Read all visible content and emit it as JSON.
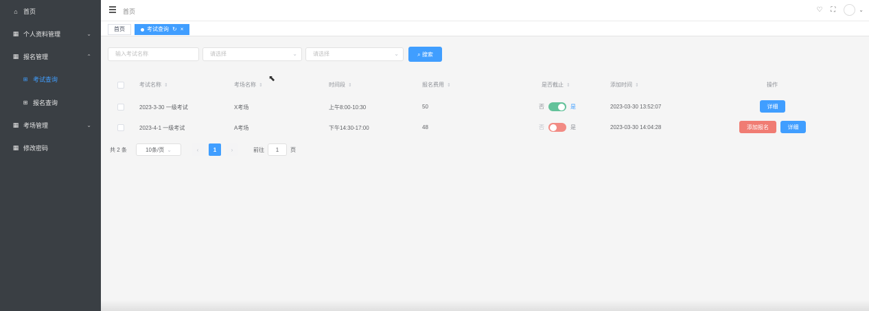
{
  "sidebar": {
    "items": [
      {
        "icon": "home-icon",
        "glyph": "⌂",
        "label": "首页"
      },
      {
        "icon": "grid-icon",
        "glyph": "▦",
        "label": "个人资料管理",
        "chevron": "⌄"
      },
      {
        "icon": "grid-icon",
        "glyph": "▦",
        "label": "报名管理",
        "chevron": "⌃"
      },
      {
        "icon": "sub-grid-icon",
        "glyph": "⊞",
        "label": "考试查询",
        "active": true
      },
      {
        "icon": "sub-grid-icon",
        "glyph": "⊞",
        "label": "报名查询"
      },
      {
        "icon": "grid-icon",
        "glyph": "▦",
        "label": "考场管理",
        "chevron": "⌄"
      },
      {
        "icon": "grid-icon",
        "glyph": "▦",
        "label": "修改密码"
      }
    ]
  },
  "header": {
    "breadcrumb": "首页",
    "icons": {
      "shirt": "♡",
      "fullscreen": "⛶",
      "dropdown": "⌄"
    }
  },
  "tags": {
    "home": "首页",
    "active": "考试查询",
    "refresh_glyph": "↻",
    "close_glyph": "×"
  },
  "filters": {
    "name_placeholder": "输入考试名称",
    "select1_placeholder": "请选择",
    "select2_placeholder": "请选择",
    "arrow_glyph": "⌄",
    "search_label": "⌕ 搜索"
  },
  "table": {
    "headers": [
      "考试名称",
      "考场名称",
      "时间段",
      "报名费用",
      "是否截止",
      "添加时间",
      "操作"
    ],
    "sort_glyph": "⇕",
    "rows": [
      {
        "exam": "2023-3-30 一级考试",
        "room": "X考场",
        "time": "上午8:00-10:30",
        "fee": "50",
        "off": "否",
        "on": "是",
        "deadline_on": true,
        "added": "2023-03-30 13:52:07",
        "detail": "详细"
      },
      {
        "exam": "2023-4-1 一级考试",
        "room": "A考场",
        "time": "下午14:30-17:00",
        "fee": "48",
        "off": "否",
        "on": "是",
        "deadline_on": false,
        "added": "2023-03-30 14:04:28",
        "signup": "添加报名",
        "detail": "详细"
      }
    ]
  },
  "pagination": {
    "total": "共 2 条",
    "page_size": "10条/页",
    "prev": "‹",
    "current": "1",
    "next": "›",
    "goto_prefix": "前往",
    "goto_value": "1",
    "goto_suffix": "页"
  },
  "colors": {
    "primary": "#409eff",
    "danger": "#f07c73",
    "sidebar": "#3a3f44",
    "switch_on": "#63c29a",
    "switch_off": "#f28b84"
  }
}
